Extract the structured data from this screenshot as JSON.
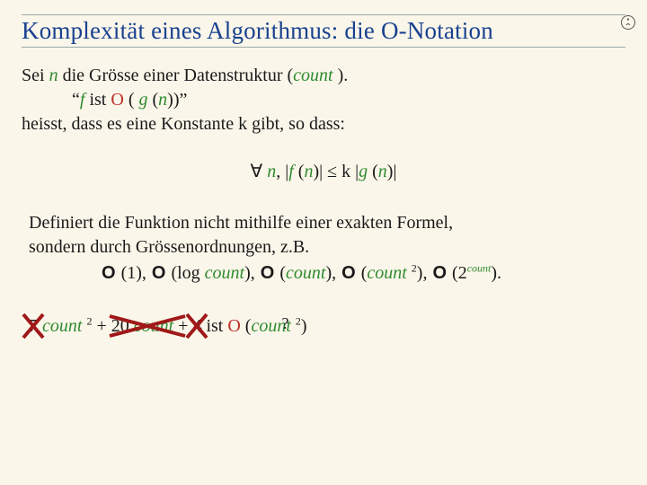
{
  "title": "Komplexität eines Algorithmus: die O-Notation",
  "intro": {
    "l1_a": "Sei ",
    "l1_n": "n",
    "l1_b": " die Grösse einer Datenstruktur (",
    "l1_count": "count ",
    "l1_c": ").",
    "l2_a": "“",
    "l2_f": "f",
    "l2_b": " ist ",
    "l2_O": "O",
    "l2_c": " ( ",
    "l2_g": "g ",
    "l2_d": "(",
    "l2_n": "n",
    "l2_e": "))”",
    "l3": "heisst, dass es eine Konstante k gibt, so dass:"
  },
  "math": {
    "forall": "∀ ",
    "n1": "n",
    "sep": ", |",
    "f": "f ",
    "paren1": "(",
    "n2": "n",
    "mid": ")| ≤ k |",
    "g": "g ",
    "paren2": "(",
    "n3": "n",
    "end": ")|"
  },
  "para2": {
    "l1": "Definiert die Funktion nicht mithilfe einer exakten Formel,",
    "l2": "sondern durch Grössenordnungen, z.B."
  },
  "orders": {
    "O": "O",
    "o1": " (1), ",
    "o2a": " (log ",
    "count": "count",
    "o2b": "), ",
    "o3a": " (",
    "o3b": "), ",
    "o4a": " (",
    "o4b": " ",
    "exp2": "2",
    "o4c": "), ",
    "o5a": " (2",
    "o5b": ")."
  },
  "eq": {
    "t1a": "7 ",
    "t1b": " ",
    "t1exp": "2",
    "plus": " + ",
    "t2a": "20 ",
    "t3": "4",
    "ist": " ist   ",
    "resA": " (",
    "resB": " ",
    "resExp": "2",
    "resC": ")",
    "q": "?"
  },
  "icons": {
    "corner": "slide-badge-icon"
  }
}
